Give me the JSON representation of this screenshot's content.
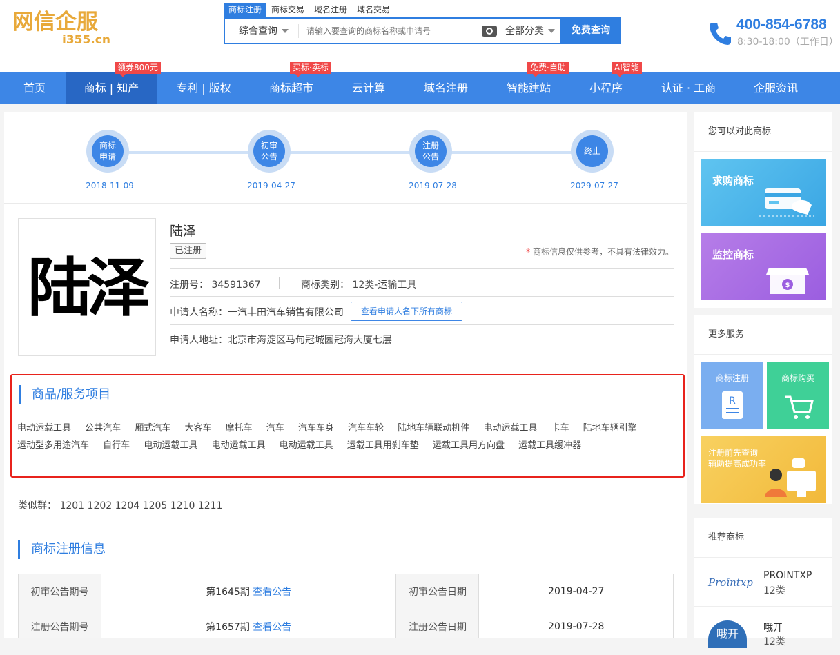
{
  "header": {
    "logo_main": "网信企服",
    "logo_sub": "i355.cn",
    "search_tabs": [
      "商标注册",
      "商标交易",
      "域名注册",
      "域名交易"
    ],
    "search_type": "综合查询",
    "search_placeholder": "请输入要查询的商标名称或申请号",
    "category_select": "全部分类",
    "search_button": "免费查询",
    "phone": "400-854-6788",
    "hours": "8:30-18:00（工作日）"
  },
  "nav": {
    "items": [
      "首页",
      "商标 | 知产",
      "专利 | 版权",
      "商标超市",
      "云计算",
      "域名注册",
      "智能建站",
      "小程序",
      "认证 · 工商",
      "企服资讯"
    ],
    "badges": [
      "领券800元",
      "买标·卖标",
      "免费·自助",
      "AI智能"
    ]
  },
  "timeline": {
    "steps": [
      {
        "l1": "商标",
        "l2": "申请",
        "date": "2018-11-09"
      },
      {
        "l1": "初审",
        "l2": "公告",
        "date": "2019-04-27"
      },
      {
        "l1": "注册",
        "l2": "公告",
        "date": "2019-07-28"
      },
      {
        "l1": "终止",
        "l2": "",
        "date": "2029-07-27"
      }
    ]
  },
  "trademark": {
    "image_text": "陆泽",
    "name": "陆泽",
    "status": "已注册",
    "note_star": "*",
    "note": "商标信息仅供参考，不具有法律效力。",
    "reg_no_label": "注册号：",
    "reg_no": "34591367",
    "class_label": "商标类别：",
    "class": "12类-运输工具",
    "applicant_label": "申请人名称：",
    "applicant": "一汽丰田汽车销售有限公司",
    "view_all_button": "查看申请人名下所有商标",
    "address_label": "申请人地址：",
    "address": "北京市海淀区马甸冠城园冠海大厦七层"
  },
  "goods": {
    "title": "商品/服务项目",
    "items": [
      "电动运载工具",
      "公共汽车",
      "厢式汽车",
      "大客车",
      "摩托车",
      "汽车",
      "汽车车身",
      "汽车车轮",
      "陆地车辆联动机件",
      "电动运载工具",
      "卡车",
      "陆地车辆引擎",
      "运动型多用途汽车",
      "自行车",
      "电动运载工具",
      "电动运载工具",
      "电动运载工具",
      "运载工具用刹车垫",
      "运载工具用方向盘",
      "运载工具缓冲器"
    ]
  },
  "similar": {
    "label": "类似群：",
    "groups": "1201 1202 1204 1205 1210 1211"
  },
  "registration": {
    "title": "商标注册信息",
    "rows": [
      {
        "h1": "初审公告期号",
        "v1": "第1645期",
        "link": "查看公告",
        "h2": "初审公告日期",
        "v2": "2019-04-27"
      },
      {
        "h1": "注册公告期号",
        "v1": "第1657期",
        "link": "查看公告",
        "h2": "注册公告日期",
        "v2": "2019-07-28"
      }
    ]
  },
  "sidebar": {
    "compare_title": "您可以对此商标",
    "card1": "求购商标",
    "card2": "监控商标",
    "more_title": "更多服务",
    "mini1": "商标注册",
    "mini2": "商标购买",
    "banner_l1": "注册前先查询",
    "banner_l2": "辅助提高成功率",
    "rec_title": "推荐商标",
    "rec": [
      {
        "logo": "Proîntxp",
        "name": "PROINTXP",
        "class": "12类"
      },
      {
        "logo": "哦开",
        "name": "哦开",
        "class": "12类"
      }
    ]
  },
  "colors": {
    "accent": "#2f7ee0",
    "nav": "#3d86e6",
    "badge": "#f04848",
    "highlight": "#e8231c"
  }
}
